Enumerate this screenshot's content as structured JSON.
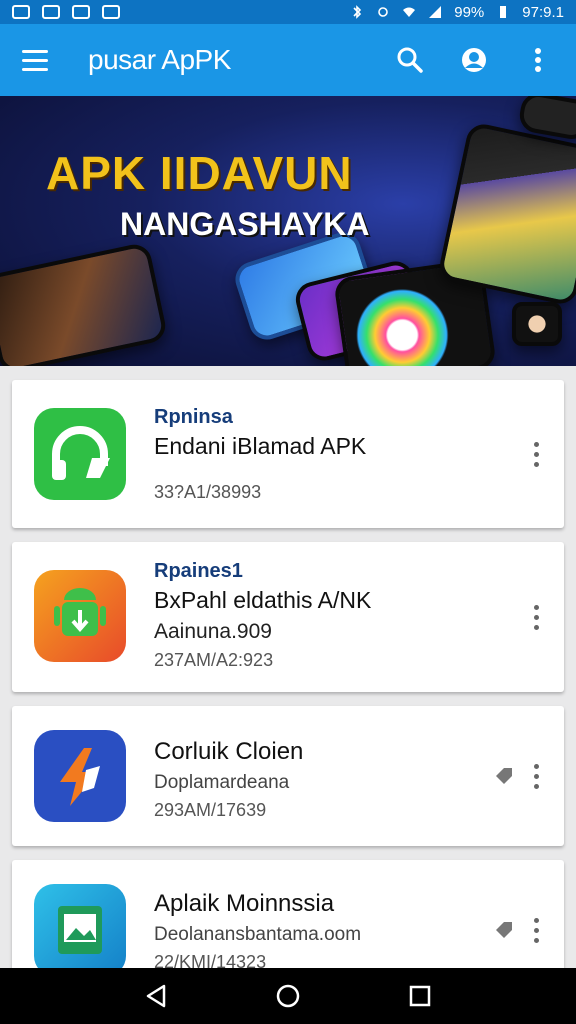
{
  "status_bar": {
    "battery": "99%",
    "time": "97:9.1"
  },
  "app_bar": {
    "title": "pusar ApPK"
  },
  "banner": {
    "title": "APK IIDAVUN",
    "subtitle": "NANGASHAYKA"
  },
  "apps": [
    {
      "category": "Rpninsa",
      "name": "Endani iBlamad APK",
      "desc": "",
      "meta": "33?A1/38993",
      "icon": "headphones-icon",
      "color": "#2fbf45"
    },
    {
      "category": "Rpaines1",
      "name": "BxPahl eldathis A/NK",
      "desc": "Aainuna.909",
      "meta": "237AM/A2:923",
      "icon": "android-download-icon",
      "color": "#f07a21"
    },
    {
      "category": "",
      "name": "Corluik Cloien",
      "desc": "Doplamardeana",
      "meta": "293AM/17639",
      "icon": "flash-app-icon",
      "color": "#2a4fc2"
    },
    {
      "category": "",
      "name": "Aplaik Moinnssia",
      "desc": "Deolanansbantama.oom",
      "meta": "22/KMI/14323",
      "icon": "photo-frame-icon",
      "color": "#1fa5dd"
    }
  ],
  "colors": {
    "status_bar": "#0d73c2",
    "app_bar": "#1a96e6",
    "category_text": "#163d7a"
  }
}
